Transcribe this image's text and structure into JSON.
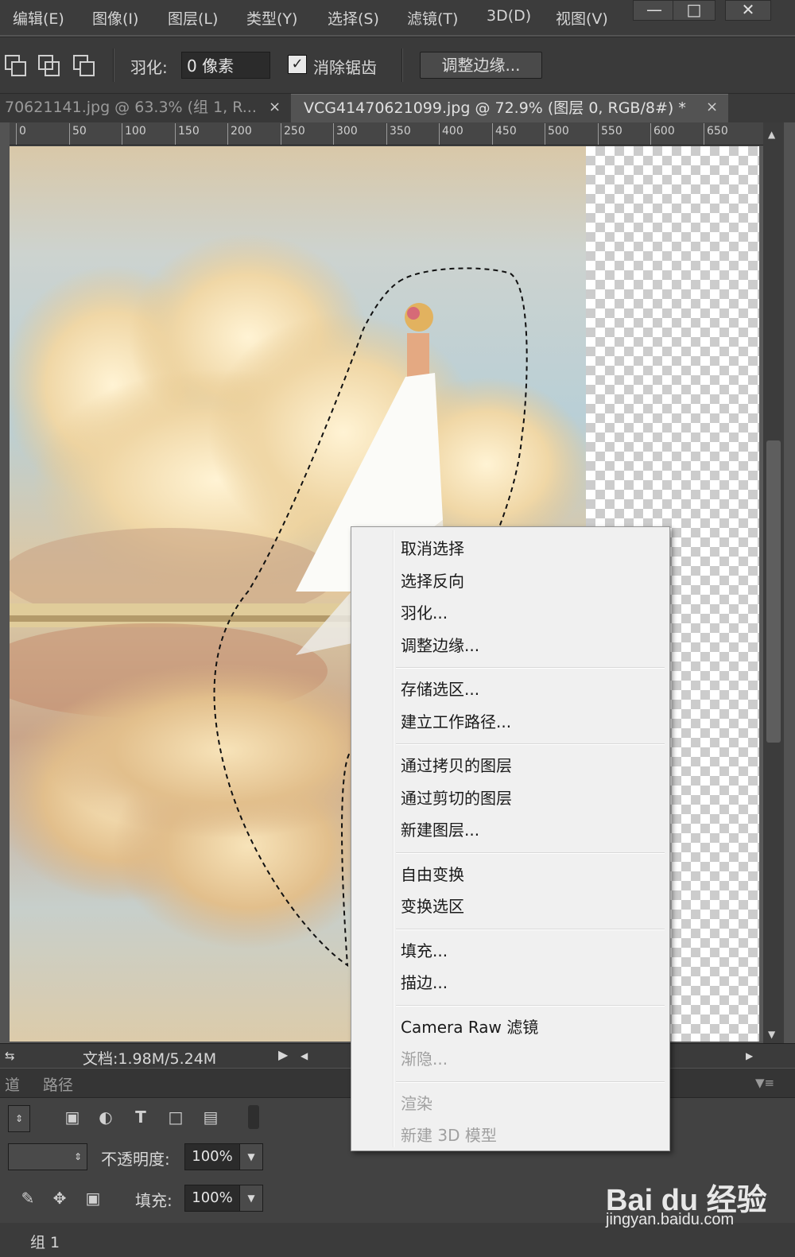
{
  "menubar": {
    "items": [
      "编辑(E)",
      "图像(I)",
      "图层(L)",
      "类型(Y)",
      "选择(S)",
      "滤镜(T)",
      "3D(D)",
      "视图(V)"
    ],
    "window_controls": [
      "minimize-icon",
      "maximize-icon",
      "close-icon"
    ]
  },
  "options": {
    "selection_modes": [
      "add-to-selection-icon",
      "subtract-from-selection-icon",
      "intersect-selection-icon"
    ],
    "feather_label": "羽化:",
    "feather_value": "0 像素",
    "antialias_checked": true,
    "antialias_label": "消除锯齿",
    "refine_edge_button": "调整边缘..."
  },
  "tabs": [
    {
      "title": "70621141.jpg @ 63.3% (组 1, R...",
      "active": false
    },
    {
      "title": "VCG41470621099.jpg @ 72.9% (图层 0, RGB/8#) *",
      "active": true
    }
  ],
  "ruler": {
    "labels": [
      "0",
      "50",
      "100",
      "150",
      "200",
      "250",
      "300",
      "350",
      "400",
      "450",
      "500",
      "550",
      "600",
      "650"
    ]
  },
  "status": {
    "doc_info": "文档:1.98M/5.24M"
  },
  "panel": {
    "tabs": [
      "道",
      "路径"
    ],
    "opacity_label": "不透明度:",
    "opacity_value": "100%",
    "fill_label": "填充:",
    "fill_value": "100%",
    "layer_name": "组 1",
    "filter_icons": [
      "image-filter-icon",
      "adjustment-filter-icon",
      "type-filter-icon",
      "shape-filter-icon",
      "smart-object-filter-icon"
    ]
  },
  "context_menu": {
    "groups": [
      [
        {
          "label": "取消选择",
          "enabled": true
        },
        {
          "label": "选择反向",
          "enabled": true
        },
        {
          "label": "羽化...",
          "enabled": true
        },
        {
          "label": "调整边缘...",
          "enabled": true
        }
      ],
      [
        {
          "label": "存储选区...",
          "enabled": true
        },
        {
          "label": "建立工作路径...",
          "enabled": true
        }
      ],
      [
        {
          "label": "通过拷贝的图层",
          "enabled": true
        },
        {
          "label": "通过剪切的图层",
          "enabled": true
        },
        {
          "label": "新建图层...",
          "enabled": true
        }
      ],
      [
        {
          "label": "自由变换",
          "enabled": true
        },
        {
          "label": "变换选区",
          "enabled": true
        }
      ],
      [
        {
          "label": "填充...",
          "enabled": true
        },
        {
          "label": "描边...",
          "enabled": true
        }
      ],
      [
        {
          "label": "Camera Raw 滤镜",
          "enabled": true
        },
        {
          "label": "渐隐...",
          "enabled": false
        }
      ],
      [
        {
          "label": "渲染",
          "enabled": false
        },
        {
          "label": "新建 3D 模型",
          "enabled": false
        }
      ]
    ]
  },
  "watermark": {
    "logo": "Bai du 经验",
    "url": "jingyan.baidu.com"
  }
}
